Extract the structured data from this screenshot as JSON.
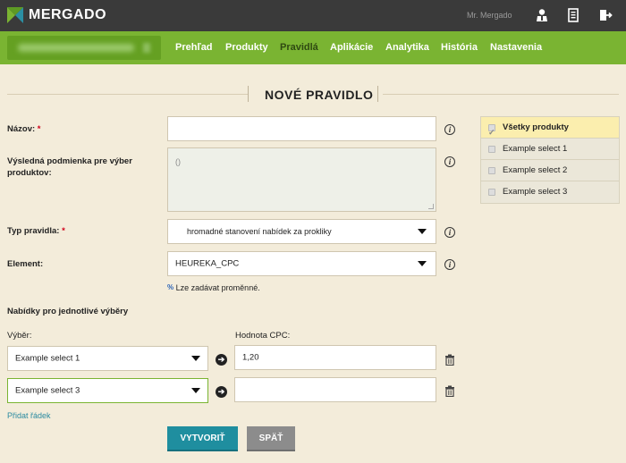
{
  "app": {
    "logo_text": "MERGADO",
    "user_name": "Mr. Mergado"
  },
  "nav": {
    "items": [
      "Prehľad",
      "Produkty",
      "Pravidlá",
      "Aplikácie",
      "Analytika",
      "História",
      "Nastavenia"
    ],
    "active": "Pravidlá"
  },
  "page": {
    "title": "NOVÉ PRAVIDLO"
  },
  "form": {
    "name_label": "Názov:",
    "name_value": "",
    "condition_label": "Výsledná podmienka pre výber produktov:",
    "condition_value": "()",
    "rule_type_label": "Typ pravidla:",
    "rule_type_value": "hromadné stanovení nabídek za prokliky",
    "element_label": "Element:",
    "element_value": "HEUREKA_CPC",
    "element_hint_symbol": "%",
    "element_hint": "Lze zadávat proměnné.",
    "required_mark": "*",
    "offers_heading": "Nabídky pro jednotlivé výběry",
    "selection_col_label": "Výběr:",
    "value_col_label": "Hodnota CPC:",
    "rows": [
      {
        "selection": "Example select 1",
        "value": "1,20"
      },
      {
        "selection": "Example select 3",
        "value": ""
      }
    ],
    "add_row_label": "Přidat řádek",
    "create_button": "VYTVORIŤ",
    "back_button": "SPÄŤ"
  },
  "selections": {
    "items": [
      {
        "label": "Všetky produkty",
        "checked": true,
        "selected": true
      },
      {
        "label": "Example select 1",
        "checked": false,
        "selected": false
      },
      {
        "label": "Example select 2",
        "checked": false,
        "selected": false
      },
      {
        "label": "Example select 3",
        "checked": false,
        "selected": false
      }
    ]
  },
  "icons": {
    "info": "i",
    "arrow": "➔"
  },
  "colors": {
    "topbar": "#3a3a3a",
    "navbar": "#7ab432",
    "background": "#f3ecda",
    "primary_button": "#1f8e9f",
    "back_button": "#8c8c8c",
    "selected_item": "#fbeeae",
    "required": "#d0021b",
    "link": "#2a8aa0"
  }
}
